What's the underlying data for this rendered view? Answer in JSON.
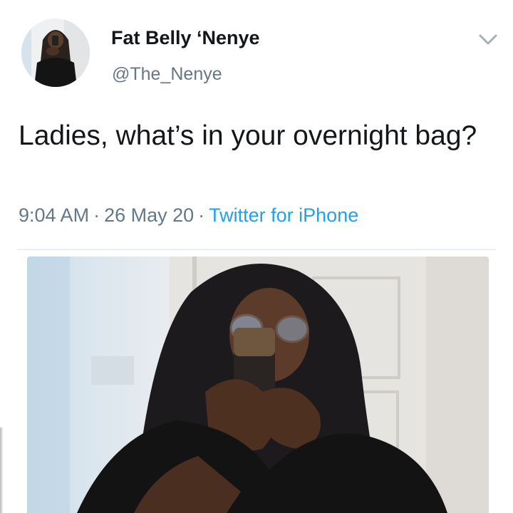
{
  "tweet": {
    "author": {
      "display_name": "Fat Belly ‘Nenye",
      "handle": "@The_Nenye"
    },
    "text": "Ladies, what’s in your overnight bag?",
    "meta": {
      "time": "9:04 AM",
      "separator": "·",
      "date": "26 May 20",
      "source": "Twitter for iPhone"
    }
  },
  "icons": {
    "menu": "chevron-down-icon"
  },
  "colors": {
    "text_primary": "#14171a",
    "text_secondary": "#657786",
    "link": "#1da1f2",
    "divider": "#e1e8ed"
  }
}
